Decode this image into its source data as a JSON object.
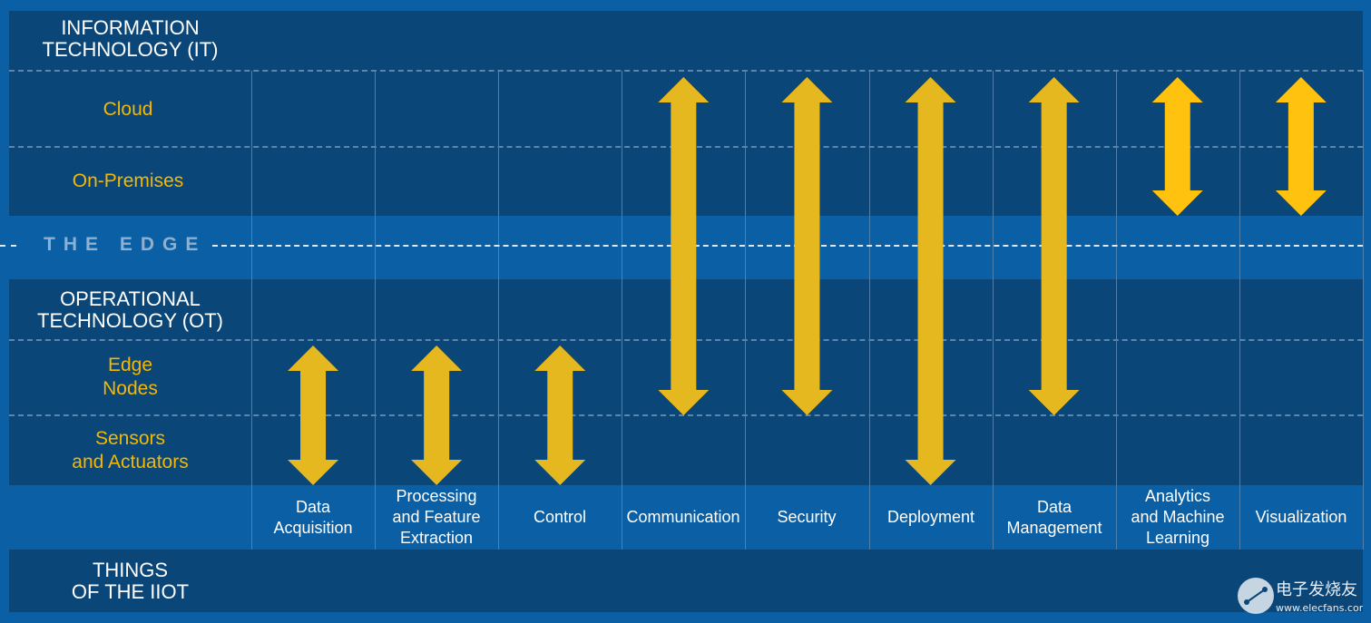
{
  "rows": {
    "it_header": [
      "INFORMATION",
      "TECHNOLOGY (IT)"
    ],
    "cloud": "Cloud",
    "on_premises": "On-Premises",
    "edge": "THE EDGE",
    "ot_header": [
      "OPERATIONAL",
      "TECHNOLOGY (OT)"
    ],
    "edge_nodes": [
      "Edge",
      "Nodes"
    ],
    "sensors": [
      "Sensors",
      "and Actuators"
    ],
    "things": [
      "THINGS",
      "OF THE IIOT"
    ]
  },
  "columns": [
    {
      "label": [
        "Data",
        "Acquisition"
      ],
      "span": [
        "Edge Nodes",
        "Sensors and Actuators"
      ]
    },
    {
      "label": [
        "Processing",
        "and Feature",
        "Extraction"
      ],
      "span": [
        "Edge Nodes",
        "Sensors and Actuators"
      ]
    },
    {
      "label": [
        "Control"
      ],
      "span": [
        "Edge Nodes",
        "Sensors and Actuators"
      ]
    },
    {
      "label": [
        "Communication"
      ],
      "span": [
        "Cloud",
        "Edge Nodes"
      ]
    },
    {
      "label": [
        "Security"
      ],
      "span": [
        "Cloud",
        "Edge Nodes"
      ]
    },
    {
      "label": [
        "Deployment"
      ],
      "span": [
        "Cloud",
        "Sensors and Actuators"
      ]
    },
    {
      "label": [
        "Data",
        "Management"
      ],
      "span": [
        "Cloud",
        "Edge Nodes"
      ]
    },
    {
      "label": [
        "Analytics",
        "and Machine",
        "Learning"
      ],
      "span": [
        "Cloud",
        "On-Premises"
      ]
    },
    {
      "label": [
        "Visualization"
      ],
      "span": [
        "Cloud",
        "On-Premises"
      ]
    }
  ],
  "colors": {
    "background": "#0b5fa5",
    "panel": "#0a4678",
    "arrow": "#e6b820",
    "arrow_bright": "#ffc20e",
    "row_label": "#f5b800"
  },
  "watermark": {
    "brand": "电子发烧友",
    "url": "www.elecfans.com"
  }
}
